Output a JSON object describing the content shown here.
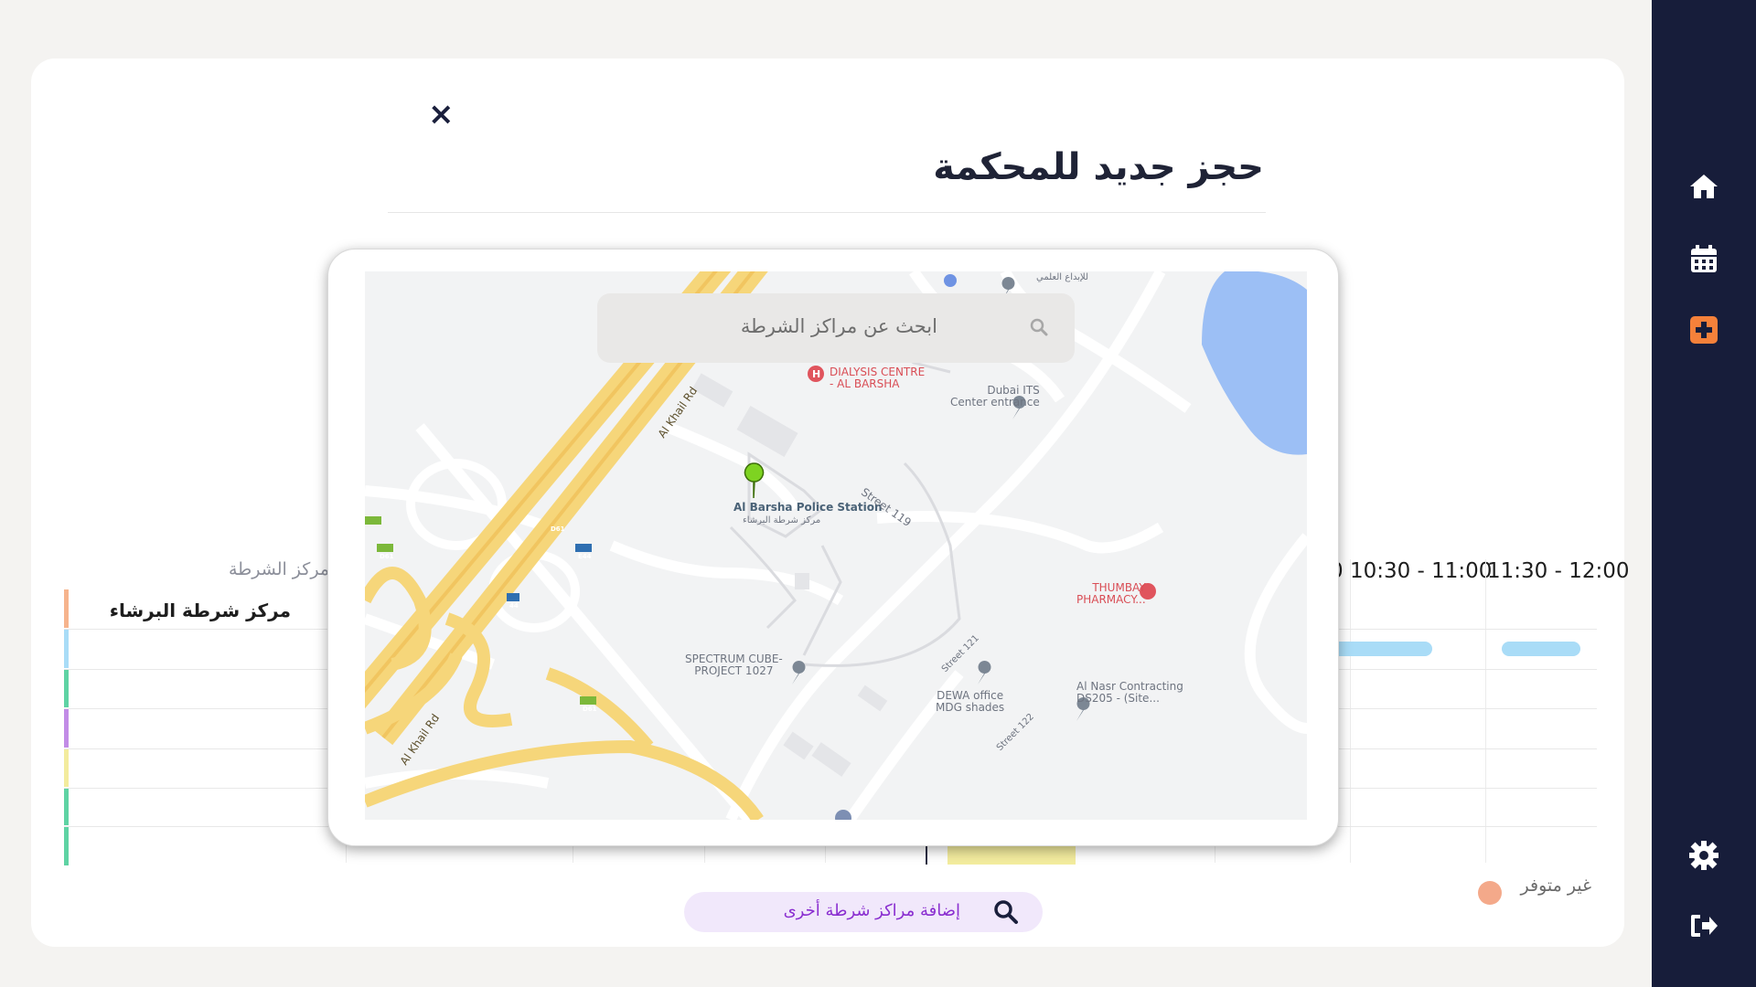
{
  "header": {
    "title": "حجز جديد للمحكمة",
    "close_glyph": "×"
  },
  "sidebar": {
    "icons": [
      "home-icon",
      "calendar-icon",
      "add-booking-icon",
      "settings-icon",
      "logout-icon"
    ]
  },
  "schedule": {
    "column_header": "مركز الشرطة",
    "time_slots": [
      "0 10:30 - 11:00",
      "11:30 - 12:00"
    ],
    "rows": [
      {
        "label": "مركز شرطة البرشاء",
        "color": "#f6b48d"
      },
      {
        "label": "",
        "color": "#a9dcf7"
      },
      {
        "label": "",
        "color": "#5fd3a4"
      },
      {
        "label": "",
        "color": "#c28ce6"
      },
      {
        "label": "",
        "color": "#f3ec9e"
      },
      {
        "label": "",
        "color": "#5fd3a4"
      },
      {
        "label": "",
        "color": "#5fd3a4"
      }
    ]
  },
  "legend": {
    "unavailable_label": "غير متوفر",
    "unavailable_color": "#f4a98a"
  },
  "add_more": {
    "label": "إضافة مراكز شرطة أخرى"
  },
  "map_modal": {
    "search_placeholder": "ابحث عن مراكز الشرطة",
    "labels": {
      "dialysis": "DIALYSIS CENTRE\n- AL BARSHA",
      "dubai_its": "Dubai ITS\nCenter entrance",
      "police_station": "Al Barsha Police Station",
      "police_station_ar": "مركز شرطة البرشاء",
      "street_119": "Street 119",
      "street_121": "Street 121",
      "street_122": "Street 122",
      "al_khail_1": "Al Khail Rd",
      "al_khail_2": "Al Khail Rd",
      "thumbay": "THUMBAY\nPHARMACY...",
      "spectrum": "SPECTRUM CUBE-\nPROJECT 1027",
      "dewa": "DEWA office\nMDG shades",
      "al_nasr": "Al Nasr Contracting\nDS205 - (Site...",
      "d61_a": "D61",
      "d61_b": "D61",
      "d61_c": "D61",
      "e44": "E44",
      "e44_b": "44",
      "top_ar": "للإبداع العلمي"
    }
  }
}
